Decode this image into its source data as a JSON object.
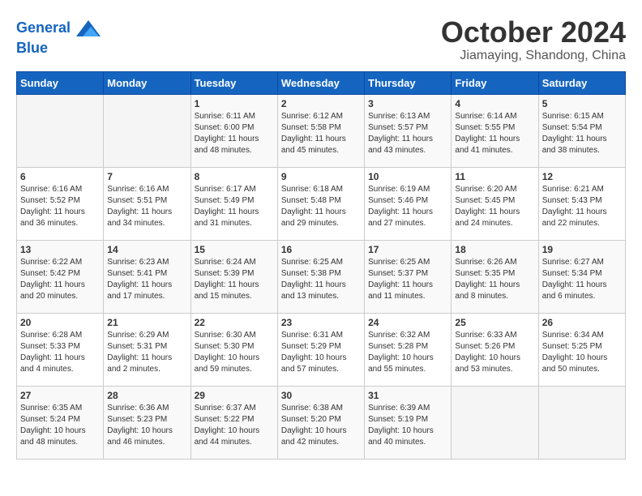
{
  "header": {
    "logo_line1": "General",
    "logo_line2": "Blue",
    "month": "October 2024",
    "location": "Jiamaying, Shandong, China"
  },
  "weekdays": [
    "Sunday",
    "Monday",
    "Tuesday",
    "Wednesday",
    "Thursday",
    "Friday",
    "Saturday"
  ],
  "weeks": [
    [
      {
        "day": "",
        "sunrise": "",
        "sunset": "",
        "daylight": ""
      },
      {
        "day": "",
        "sunrise": "",
        "sunset": "",
        "daylight": ""
      },
      {
        "day": "1",
        "sunrise": "Sunrise: 6:11 AM",
        "sunset": "Sunset: 6:00 PM",
        "daylight": "Daylight: 11 hours and 48 minutes."
      },
      {
        "day": "2",
        "sunrise": "Sunrise: 6:12 AM",
        "sunset": "Sunset: 5:58 PM",
        "daylight": "Daylight: 11 hours and 45 minutes."
      },
      {
        "day": "3",
        "sunrise": "Sunrise: 6:13 AM",
        "sunset": "Sunset: 5:57 PM",
        "daylight": "Daylight: 11 hours and 43 minutes."
      },
      {
        "day": "4",
        "sunrise": "Sunrise: 6:14 AM",
        "sunset": "Sunset: 5:55 PM",
        "daylight": "Daylight: 11 hours and 41 minutes."
      },
      {
        "day": "5",
        "sunrise": "Sunrise: 6:15 AM",
        "sunset": "Sunset: 5:54 PM",
        "daylight": "Daylight: 11 hours and 38 minutes."
      }
    ],
    [
      {
        "day": "6",
        "sunrise": "Sunrise: 6:16 AM",
        "sunset": "Sunset: 5:52 PM",
        "daylight": "Daylight: 11 hours and 36 minutes."
      },
      {
        "day": "7",
        "sunrise": "Sunrise: 6:16 AM",
        "sunset": "Sunset: 5:51 PM",
        "daylight": "Daylight: 11 hours and 34 minutes."
      },
      {
        "day": "8",
        "sunrise": "Sunrise: 6:17 AM",
        "sunset": "Sunset: 5:49 PM",
        "daylight": "Daylight: 11 hours and 31 minutes."
      },
      {
        "day": "9",
        "sunrise": "Sunrise: 6:18 AM",
        "sunset": "Sunset: 5:48 PM",
        "daylight": "Daylight: 11 hours and 29 minutes."
      },
      {
        "day": "10",
        "sunrise": "Sunrise: 6:19 AM",
        "sunset": "Sunset: 5:46 PM",
        "daylight": "Daylight: 11 hours and 27 minutes."
      },
      {
        "day": "11",
        "sunrise": "Sunrise: 6:20 AM",
        "sunset": "Sunset: 5:45 PM",
        "daylight": "Daylight: 11 hours and 24 minutes."
      },
      {
        "day": "12",
        "sunrise": "Sunrise: 6:21 AM",
        "sunset": "Sunset: 5:43 PM",
        "daylight": "Daylight: 11 hours and 22 minutes."
      }
    ],
    [
      {
        "day": "13",
        "sunrise": "Sunrise: 6:22 AM",
        "sunset": "Sunset: 5:42 PM",
        "daylight": "Daylight: 11 hours and 20 minutes."
      },
      {
        "day": "14",
        "sunrise": "Sunrise: 6:23 AM",
        "sunset": "Sunset: 5:41 PM",
        "daylight": "Daylight: 11 hours and 17 minutes."
      },
      {
        "day": "15",
        "sunrise": "Sunrise: 6:24 AM",
        "sunset": "Sunset: 5:39 PM",
        "daylight": "Daylight: 11 hours and 15 minutes."
      },
      {
        "day": "16",
        "sunrise": "Sunrise: 6:25 AM",
        "sunset": "Sunset: 5:38 PM",
        "daylight": "Daylight: 11 hours and 13 minutes."
      },
      {
        "day": "17",
        "sunrise": "Sunrise: 6:25 AM",
        "sunset": "Sunset: 5:37 PM",
        "daylight": "Daylight: 11 hours and 11 minutes."
      },
      {
        "day": "18",
        "sunrise": "Sunrise: 6:26 AM",
        "sunset": "Sunset: 5:35 PM",
        "daylight": "Daylight: 11 hours and 8 minutes."
      },
      {
        "day": "19",
        "sunrise": "Sunrise: 6:27 AM",
        "sunset": "Sunset: 5:34 PM",
        "daylight": "Daylight: 11 hours and 6 minutes."
      }
    ],
    [
      {
        "day": "20",
        "sunrise": "Sunrise: 6:28 AM",
        "sunset": "Sunset: 5:33 PM",
        "daylight": "Daylight: 11 hours and 4 minutes."
      },
      {
        "day": "21",
        "sunrise": "Sunrise: 6:29 AM",
        "sunset": "Sunset: 5:31 PM",
        "daylight": "Daylight: 11 hours and 2 minutes."
      },
      {
        "day": "22",
        "sunrise": "Sunrise: 6:30 AM",
        "sunset": "Sunset: 5:30 PM",
        "daylight": "Daylight: 10 hours and 59 minutes."
      },
      {
        "day": "23",
        "sunrise": "Sunrise: 6:31 AM",
        "sunset": "Sunset: 5:29 PM",
        "daylight": "Daylight: 10 hours and 57 minutes."
      },
      {
        "day": "24",
        "sunrise": "Sunrise: 6:32 AM",
        "sunset": "Sunset: 5:28 PM",
        "daylight": "Daylight: 10 hours and 55 minutes."
      },
      {
        "day": "25",
        "sunrise": "Sunrise: 6:33 AM",
        "sunset": "Sunset: 5:26 PM",
        "daylight": "Daylight: 10 hours and 53 minutes."
      },
      {
        "day": "26",
        "sunrise": "Sunrise: 6:34 AM",
        "sunset": "Sunset: 5:25 PM",
        "daylight": "Daylight: 10 hours and 50 minutes."
      }
    ],
    [
      {
        "day": "27",
        "sunrise": "Sunrise: 6:35 AM",
        "sunset": "Sunset: 5:24 PM",
        "daylight": "Daylight: 10 hours and 48 minutes."
      },
      {
        "day": "28",
        "sunrise": "Sunrise: 6:36 AM",
        "sunset": "Sunset: 5:23 PM",
        "daylight": "Daylight: 10 hours and 46 minutes."
      },
      {
        "day": "29",
        "sunrise": "Sunrise: 6:37 AM",
        "sunset": "Sunset: 5:22 PM",
        "daylight": "Daylight: 10 hours and 44 minutes."
      },
      {
        "day": "30",
        "sunrise": "Sunrise: 6:38 AM",
        "sunset": "Sunset: 5:20 PM",
        "daylight": "Daylight: 10 hours and 42 minutes."
      },
      {
        "day": "31",
        "sunrise": "Sunrise: 6:39 AM",
        "sunset": "Sunset: 5:19 PM",
        "daylight": "Daylight: 10 hours and 40 minutes."
      },
      {
        "day": "",
        "sunrise": "",
        "sunset": "",
        "daylight": ""
      },
      {
        "day": "",
        "sunrise": "",
        "sunset": "",
        "daylight": ""
      }
    ]
  ]
}
